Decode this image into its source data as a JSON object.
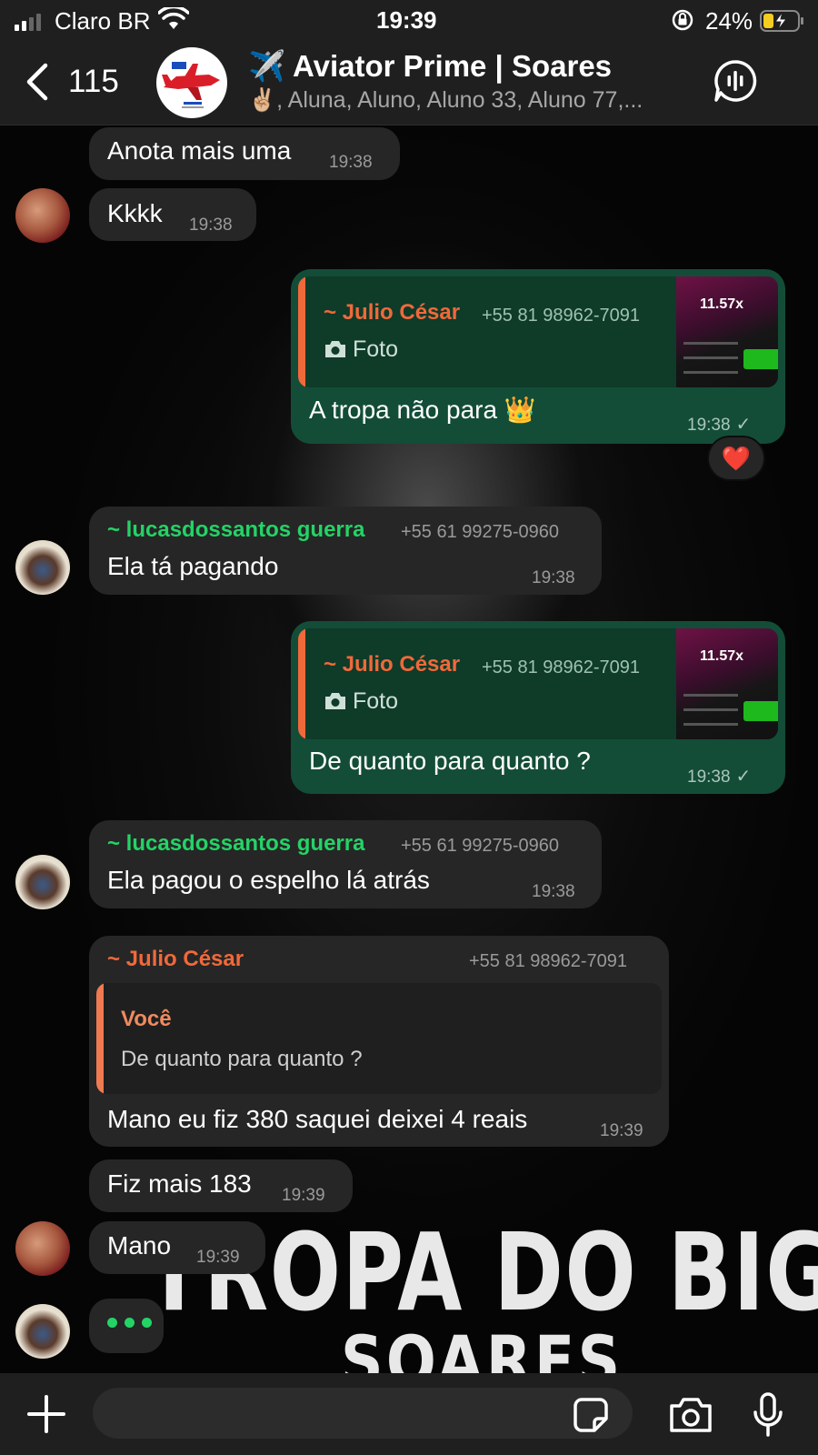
{
  "status_bar": {
    "carrier": "Claro BR",
    "time": "19:39",
    "battery_percent": "24%"
  },
  "header": {
    "back_count": "115",
    "title": "✈️ Aviator Prime | Soares",
    "subtitle": "✌🏼, Aluna, Aluno, Aluno 33, Aluno 77,..."
  },
  "wallpaper": {
    "title": "TROPA DO BIGODE",
    "subtitle": "SOARES"
  },
  "messages": {
    "m1": {
      "text": "Anota mais uma",
      "time": "19:38"
    },
    "m2": {
      "text": "Kkkk",
      "time": "19:38"
    },
    "m3": {
      "quote_sender": "~ Julio César",
      "quote_phone": "+55 81 98962-7091",
      "quote_type": "Foto",
      "thumb_label": "11.57x",
      "text": "A tropa não para 👑",
      "time": "19:38",
      "reaction": "❤️"
    },
    "m4": {
      "sender": "~ lucasdossantos guerra",
      "phone": "+55 61 99275-0960",
      "text": "Ela tá pagando",
      "time": "19:38"
    },
    "m5": {
      "quote_sender": "~ Julio César",
      "quote_phone": "+55 81 98962-7091",
      "quote_type": "Foto",
      "thumb_label": "11.57x",
      "text": "De quanto para quanto ?",
      "time": "19:38"
    },
    "m6": {
      "sender": "~ lucasdossantos guerra",
      "phone": "+55 61 99275-0960",
      "text": "Ela pagou o espelho lá atrás",
      "time": "19:38"
    },
    "m7": {
      "sender": "~ Julio César",
      "phone": "+55 81 98962-7091",
      "quote_sender": "Você",
      "quote_text": "De quanto para quanto ?",
      "text": "Mano eu fiz 380 saquei deixei 4 reais",
      "time": "19:39"
    },
    "m8": {
      "text": "Fiz mais 183",
      "time": "19:39"
    },
    "m9": {
      "text": "Mano",
      "time": "19:39"
    }
  },
  "icons": {
    "back": "chevron-left-icon",
    "call": "group-call-icon",
    "plus": "plus-icon",
    "sticker": "sticker-icon",
    "camera": "camera-icon",
    "mic": "microphone-icon",
    "quote_camera": "camera-icon"
  },
  "colors": {
    "outgoing_bubble": "#134d37",
    "incoming_bubble": "#262626",
    "sender_green": "#24d366",
    "sender_orange": "#f0693a"
  }
}
